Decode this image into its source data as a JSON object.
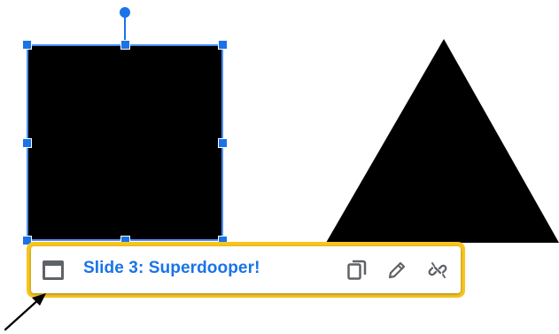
{
  "link_chip": {
    "label": "Slide 3: Superdooper!",
    "accent_color": "#1a73e8",
    "highlight_color": "#f8c51c",
    "icons": [
      "slide-icon",
      "copy-icon",
      "edit-pencil-icon",
      "unlink-icon"
    ]
  },
  "shapes": {
    "square_fill": "#000000",
    "triangle_fill": "#000000",
    "selection_color": "#1a73e8"
  }
}
